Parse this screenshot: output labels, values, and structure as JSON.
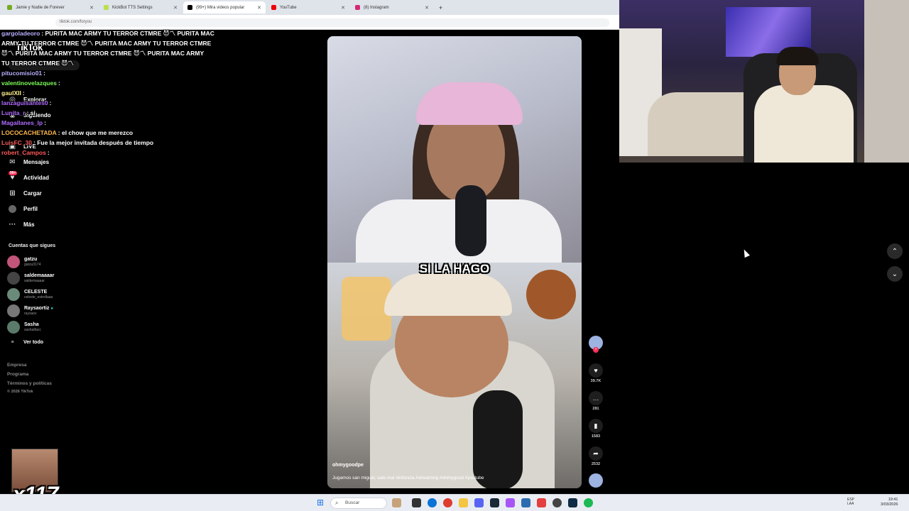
{
  "browser": {
    "tabs": [
      {
        "label": "Jamie y Nudie de Forever",
        "color": "#7a2"
      },
      {
        "label": "KickBot TTS Settings",
        "color": "#b9e04a"
      },
      {
        "label": "(99+) Mira videos popular",
        "color": "#000"
      },
      {
        "label": "YouTube",
        "color": "#e00"
      },
      {
        "label": "(8) Instagram",
        "color": "#d62976"
      }
    ],
    "url": "tiktok.com/foryou",
    "new_tab": "+"
  },
  "sidebar": {
    "logo": "TikTok",
    "search_placeholder": "Buscar",
    "items": [
      {
        "label": "Explorar",
        "icon": "compass-icon",
        "glyph": "◎"
      },
      {
        "label": "Siguiendo",
        "icon": "following-icon",
        "glyph": "◉"
      },
      {
        "label": "LIVE",
        "icon": "live-icon",
        "glyph": "▣"
      },
      {
        "label": "Mensajes",
        "icon": "message-icon",
        "glyph": "✉"
      },
      {
        "label": "Actividad",
        "icon": "activity-icon",
        "glyph": "♥"
      },
      {
        "label": "Cargar",
        "icon": "upload-icon",
        "glyph": "⊞"
      },
      {
        "label": "Perfil",
        "icon": "profile-icon",
        "glyph": "●"
      },
      {
        "label": "Más",
        "icon": "more-icon",
        "glyph": "···"
      }
    ],
    "badge": "99+",
    "following_title": "Cuentas que sigues",
    "accounts": [
      {
        "name": "gatzu",
        "handle": "gatzu3174"
      },
      {
        "name": "saldemaaaar",
        "handle": "saldemaaaar"
      },
      {
        "name": "CELESTE",
        "handle": "celeste_estrellaaa"
      },
      {
        "name": "Raysaortiz",
        "handle": "raysaov"
      },
      {
        "name": "Sasha",
        "handle": "sashatfacc"
      }
    ],
    "see_all": "Ver todo",
    "footer": [
      "Empresa",
      "Programa",
      "Términos y políticas",
      "© 2026 TikTok"
    ]
  },
  "chat": [
    {
      "user": "gargoladeoro",
      "color": "#b9b0ff",
      "msg": "PURITA MAC ARMY TU TERROR CTMRE 😈〽 PURITA MAC"
    },
    {
      "user": "",
      "color": "#fff",
      "msg": "ARMY TU TERROR CTMRE 😈〽 PURITA MAC ARMY TU TERROR CTMRE"
    },
    {
      "user": "",
      "color": "#fff",
      "msg": "😈〽 PURITA MAC ARMY TU TERROR CTMRE 😈〽 PURITA MAC ARMY"
    },
    {
      "user": "",
      "color": "#fff",
      "msg": "TU TERROR CTMRE 😈〽"
    },
    {
      "user": "pitucomisio01",
      "color": "#b9b0ff",
      "msg": ""
    },
    {
      "user": "valentinovelazques",
      "color": "#7dff5a",
      "msg": ""
    },
    {
      "user": "gaulXII",
      "color": "#fff28a",
      "msg": ""
    },
    {
      "user": "lanzaguisantes0",
      "color": "#b06bff",
      "msg": ""
    },
    {
      "user": "Lunita_r",
      "color": "#b06bff",
      "msg": "si"
    },
    {
      "user": "Magallanes_lp",
      "color": "#b06bff",
      "msg": ""
    },
    {
      "user": "LOCOCACHETADA",
      "color": "#ffb84d",
      "msg": "el chow que me merezco"
    },
    {
      "user": "LuisFC_30",
      "color": "#ff5a5a",
      "msg": "Fue la mejor invitada después de tiempo"
    },
    {
      "user": "robert_Campos",
      "color": "#ff5a5a",
      "msg": ""
    }
  ],
  "video": {
    "caption": "SI LA HAGO",
    "author": "ohmygoodpe",
    "description": "Jugamos san miguel, sale mal #infancia #streaming #ohmygood #youtube"
  },
  "actions": [
    {
      "name": "like",
      "glyph": "♥",
      "count": "39.7K"
    },
    {
      "name": "comment",
      "glyph": "…",
      "count": "281"
    },
    {
      "name": "save",
      "glyph": "▮",
      "count": "1583"
    },
    {
      "name": "share",
      "glyph": "➦",
      "count": "2532"
    }
  ],
  "scroll": {
    "up": "⌃",
    "down": "⌄"
  },
  "overlay": {
    "multiplier": "x117"
  },
  "taskbar": {
    "search_placeholder": "Buscar",
    "lang_top": "ESP",
    "lang_bottom": "LAA",
    "time": "19:41",
    "date": "3/03/2026"
  }
}
